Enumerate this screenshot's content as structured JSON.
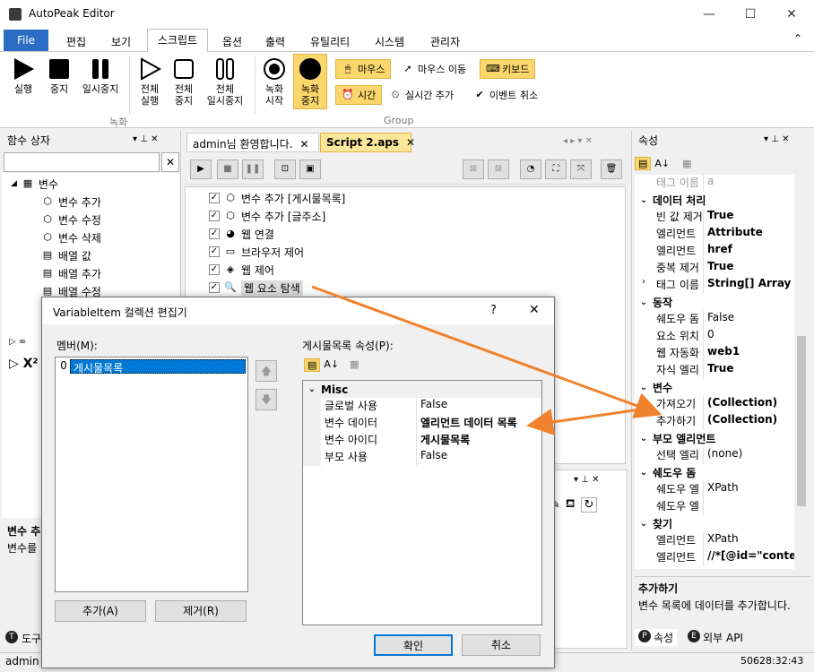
{
  "window": {
    "title": "AutoPeak Editor",
    "min": "—",
    "max": "☐",
    "close": "✕"
  },
  "menu": {
    "file": "File",
    "items": [
      "편집",
      "보기",
      "스크립트",
      "옵션",
      "출력",
      "유틸리티",
      "시스템",
      "관리자"
    ],
    "active": "스크립트",
    "collapse": "⌃"
  },
  "ribbon": {
    "run": "실행",
    "stop": "중지",
    "pause": "일시중지",
    "all_run": [
      "전체",
      "실행"
    ],
    "all_stop": [
      "전체",
      "중지"
    ],
    "all_pause": [
      "전체",
      "일시중지"
    ],
    "rec_start": [
      "녹화",
      "시작"
    ],
    "rec_stop": [
      "녹화",
      "중지"
    ],
    "group_record": "녹화",
    "group_main": "Group",
    "mouse": "마우스",
    "mouse_move": "마우스 이동",
    "keyboard": "키보드",
    "time": "시간",
    "realtime_add": "실시간 추가",
    "event_cancel": "이벤트 취소"
  },
  "left_panel": {
    "title": "함수 상자",
    "search_clear": "✕",
    "root": "변수",
    "items": [
      "변수 추가",
      "변수 수정",
      "변수 삭제",
      "배열 값",
      "배열 추가",
      "배열 수정"
    ],
    "desc_title": "변수 추",
    "desc_text": "변수를",
    "bottom_tab": "도구"
  },
  "tabs": {
    "welcome": "admin님 환영합니다.",
    "script": "Script 2.aps"
  },
  "script_lines": [
    "변수 추가 [게시물목록]",
    "변수 추가 [글주소]",
    "웹 연결",
    "브라우저 제어",
    "웹 제어",
    "웹 요소 탐색"
  ],
  "right_panel": {
    "title": "속성",
    "rows": [
      {
        "t": "row",
        "k": "태그 이름",
        "v": "a",
        "dim": true
      },
      {
        "t": "cat",
        "k": "데이터 처리"
      },
      {
        "t": "row",
        "k": "빈 값 제거",
        "v": "True",
        "b": true
      },
      {
        "t": "row",
        "k": "엘리먼트",
        "v": "Attribute",
        "b": true
      },
      {
        "t": "row",
        "k": "엘리먼트",
        "v": "href",
        "b": true
      },
      {
        "t": "row",
        "k": "중복 제거",
        "v": "True",
        "b": true
      },
      {
        "t": "row",
        "k": "태그 이름",
        "v": "String[] Array",
        "b": true,
        "exp": true
      },
      {
        "t": "cat",
        "k": "동작"
      },
      {
        "t": "row",
        "k": "쉐도우 돔",
        "v": "False"
      },
      {
        "t": "row",
        "k": "요소 위치",
        "v": "0"
      },
      {
        "t": "row",
        "k": "웹 자동화",
        "v": "web1",
        "b": true
      },
      {
        "t": "row",
        "k": "자식 엘리",
        "v": "True",
        "b": true
      },
      {
        "t": "cat",
        "k": "변수"
      },
      {
        "t": "row",
        "k": "가져오기",
        "v": "(Collection)",
        "b": true
      },
      {
        "t": "row",
        "k": "추가하기",
        "v": "(Collection)",
        "b": true
      },
      {
        "t": "cat",
        "k": "부모 엘리먼트"
      },
      {
        "t": "row",
        "k": "선택 엘리",
        "v": "(none)"
      },
      {
        "t": "cat",
        "k": "쉐도우 돔"
      },
      {
        "t": "row",
        "k": "쉐도우 엘",
        "v": "XPath"
      },
      {
        "t": "row",
        "k": "쉐도우 엘",
        "v": ""
      },
      {
        "t": "cat",
        "k": "찾기"
      },
      {
        "t": "row",
        "k": "엘리먼트",
        "v": "XPath"
      },
      {
        "t": "row",
        "k": "엘리먼트",
        "v": "//*[@id=\"conten",
        "b": true
      }
    ],
    "desc_title": "추가하기",
    "desc_text": "변수 목록에 데이터를 추가합니다.",
    "tab_props": "속성",
    "tab_api": "외부 API"
  },
  "dialog": {
    "title": "VariableItem 컬렉션 편집기",
    "help": "?",
    "close": "✕",
    "members_label": "멤버(M):",
    "member_index": "0",
    "member_name": "게시물목록",
    "props_label": "게시물목록 속성(P):",
    "category": "Misc",
    "props": [
      {
        "k": "글로벌 사용",
        "v": "False"
      },
      {
        "k": "변수 데이터",
        "v": "엘리먼트 데이터 목록",
        "b": true
      },
      {
        "k": "변수 아이디",
        "v": "게시물목록",
        "b": true
      },
      {
        "k": "부모 사용",
        "v": "False"
      }
    ],
    "add": "추가(A)",
    "remove": "제거(R)",
    "ok": "확인",
    "cancel": "취소",
    "up": "🡅",
    "down": "🡇"
  },
  "status": {
    "user": "admin",
    "time": "50628:32:43"
  },
  "colors": {
    "accent": "#2b6cc4",
    "highlight": "#fbd66b",
    "arrow": "#f0812d"
  }
}
